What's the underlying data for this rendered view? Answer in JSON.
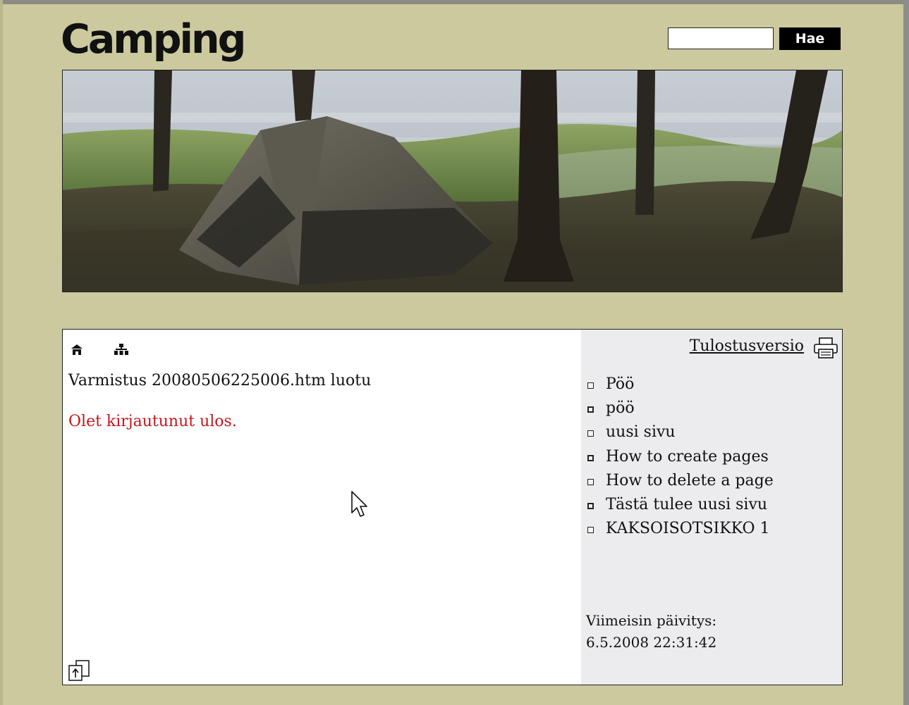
{
  "header": {
    "logo_text": "Camping",
    "search": {
      "value": "",
      "placeholder": "",
      "button_label": "Hae"
    }
  },
  "toolbar": {
    "home_icon": "home-icon",
    "sitemap_icon": "sitemap-icon"
  },
  "main": {
    "message": "Varmistus 20080506225006.htm luotu",
    "logout_message": "Olet kirjautunut ulos."
  },
  "sidebar": {
    "print_link": "Tulostusversio",
    "print_icon": "printer-icon",
    "nav_items": [
      {
        "label": "Pöö"
      },
      {
        "label": "pöö"
      },
      {
        "label": "uusi sivu"
      },
      {
        "label": "How to create pages"
      },
      {
        "label": "How to delete a page"
      },
      {
        "label": "Tästä tulee uusi sivu"
      },
      {
        "label": "KAKSOISOTSIKKO 1"
      }
    ],
    "last_updated_label": "Viimeisin päivitys:",
    "last_updated_value": "6.5.2008 22:31:42"
  },
  "colors": {
    "page_background": "#cbc99d",
    "sidebar_background": "#ececee",
    "logout_text": "#c4161c"
  }
}
